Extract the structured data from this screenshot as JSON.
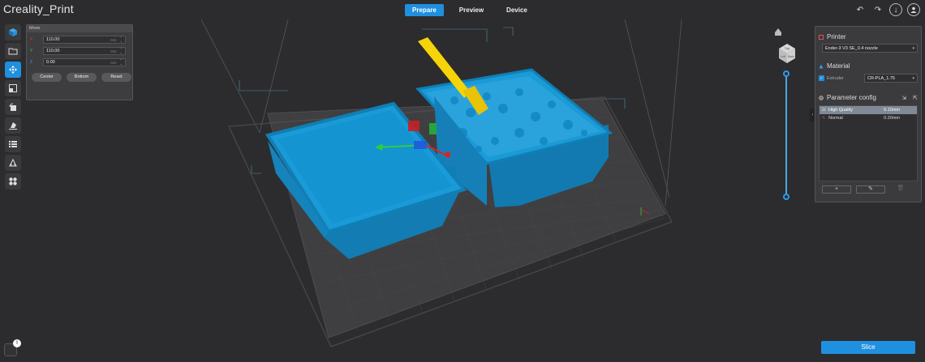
{
  "app": {
    "title": "Creality_Print"
  },
  "tabs": [
    {
      "label": "Prepare",
      "active": true
    },
    {
      "label": "Preview",
      "active": false
    },
    {
      "label": "Device",
      "active": false
    }
  ],
  "toolbar_icons": [
    "undo-icon",
    "redo-icon",
    "download-icon",
    "user-icon"
  ],
  "left_tools": [
    "add-object-icon",
    "open-file-icon",
    "move-icon",
    "scale-icon",
    "rotate-icon",
    "lay-flat-icon",
    "split-icon",
    "support-icon",
    "arrange-icon"
  ],
  "move_panel": {
    "title": "Move",
    "x": {
      "label": "X",
      "value": "110.00",
      "unit": "mm"
    },
    "y": {
      "label": "Y",
      "value": "110.00",
      "unit": "mm"
    },
    "z": {
      "label": "Z",
      "value": "0.00",
      "unit": "mm"
    },
    "buttons": {
      "center": "Center",
      "bottom": "Bottom",
      "reset": "Reset"
    }
  },
  "nav_cube": {
    "top": "Top",
    "left": "Left",
    "right": "Back"
  },
  "printer": {
    "title": "Printer",
    "selected": "Ender-3 V3 SE_0.4 nozzle"
  },
  "material": {
    "title": "Material",
    "extruder_label": "Extruder",
    "selected": "CR-PLA_1.75"
  },
  "parameter_config": {
    "title": "Parameter config",
    "profiles": [
      {
        "name": "High Quality",
        "layer": "0.10mm",
        "selected": true
      },
      {
        "name": "Normal",
        "layer": "0.20mm",
        "selected": false
      }
    ],
    "buttons": {
      "add": "+",
      "edit": "✎",
      "delete": "🗑"
    }
  },
  "slice": {
    "label": "Slice"
  },
  "notification": {
    "count": "!"
  },
  "colors": {
    "accent": "#1f8fe0",
    "model": "#1a9ad6",
    "highlight": "#f5d40a"
  }
}
